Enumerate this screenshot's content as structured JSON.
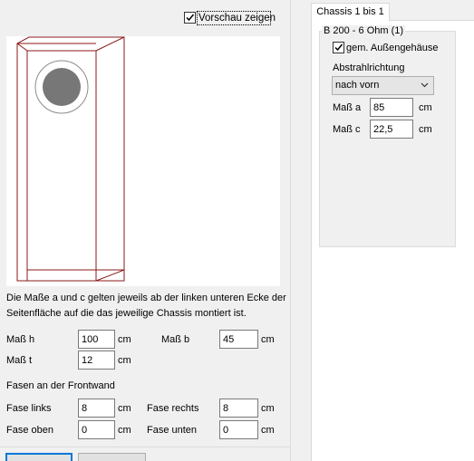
{
  "preview_toggle": {
    "label": "Vorschau zeigen",
    "checked": true
  },
  "description": {
    "line1": "Die Maße a und c gelten jeweils ab der linken unteren Ecke der",
    "line2": "Seitenfläche auf die das jeweilige Chassis montiert ist."
  },
  "dimensions": {
    "h": {
      "label": "Maß h",
      "value": "100",
      "unit": "cm"
    },
    "b": {
      "label": "Maß b",
      "value": "45",
      "unit": "cm"
    },
    "t": {
      "label": "Maß t",
      "value": "12",
      "unit": "cm"
    }
  },
  "bevels": {
    "heading": "Fasen an der Frontwand",
    "left": {
      "label": "Fase links",
      "value": "8",
      "unit": "cm"
    },
    "right": {
      "label": "Fase rechts",
      "value": "8",
      "unit": "cm"
    },
    "top": {
      "label": "Fase oben",
      "value": "0",
      "unit": "cm"
    },
    "bottom": {
      "label": "Fase unten",
      "value": "0",
      "unit": "cm"
    }
  },
  "chassis_tab": {
    "label": "Chassis 1 bis 1",
    "group_title": "B 200 - 6 Ohm (1)",
    "shared_housing": {
      "label": "gem. Außengehäuse",
      "checked": true
    },
    "direction_label": "Abstrahlrichtung",
    "direction_value": "nach vorn",
    "a": {
      "label": "Maß a",
      "value": "85",
      "unit": "cm"
    },
    "c": {
      "label": "Maß c",
      "value": "22,5",
      "unit": "cm"
    }
  },
  "icons": {
    "checkbox_check": "check-icon",
    "combo_arrow": "chevron-down-icon"
  },
  "colors": {
    "outline": "#8b1a1a",
    "driver_fill": "#777777",
    "driver_ring": "#8b8b8b"
  }
}
